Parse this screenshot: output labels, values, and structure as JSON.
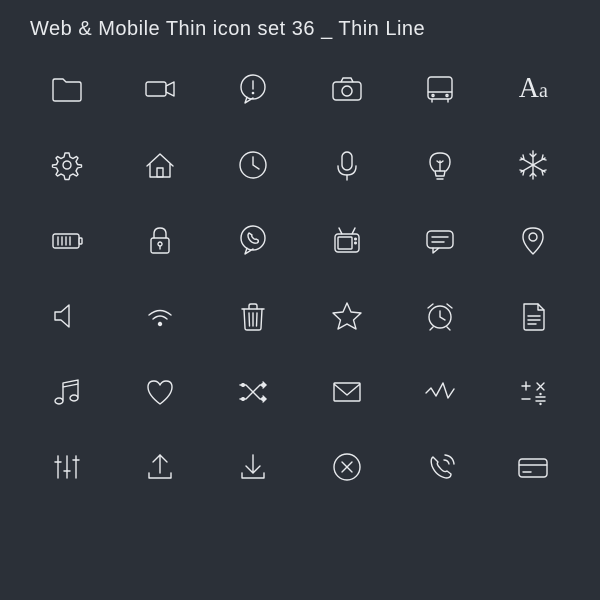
{
  "title": "Web & Mobile Thin icon set 36 _ Thin Line",
  "typography": {
    "big": "A",
    "small": "a"
  },
  "icons": [
    "folder-icon",
    "video-camera-icon",
    "alert-bubble-icon",
    "camera-icon",
    "bus-icon",
    "typography-icon",
    "gear-icon",
    "home-icon",
    "clock-icon",
    "microphone-icon",
    "lightbulb-icon",
    "snowflake-icon",
    "battery-icon",
    "lock-icon",
    "phone-bubble-icon",
    "tv-icon",
    "chat-icon",
    "location-pin-icon",
    "speaker-icon",
    "wifi-icon",
    "trash-icon",
    "star-icon",
    "alarm-clock-icon",
    "document-icon",
    "music-note-icon",
    "heart-icon",
    "shuffle-icon",
    "mail-icon",
    "activity-icon",
    "math-icon",
    "sliders-icon",
    "upload-icon",
    "download-icon",
    "close-circle-icon",
    "call-icon",
    "credit-card-icon",
    "",
    "",
    "",
    "",
    "",
    ""
  ]
}
